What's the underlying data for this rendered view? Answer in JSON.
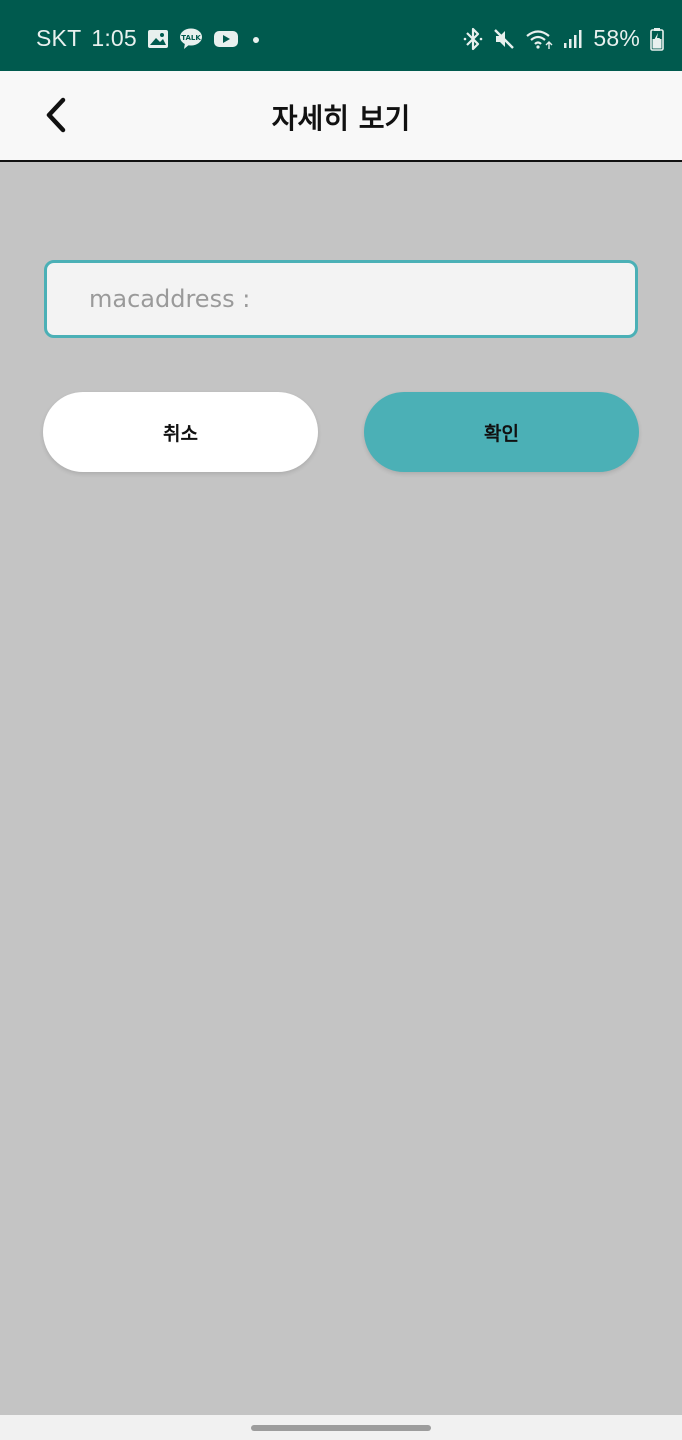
{
  "status_bar": {
    "carrier": "SKT",
    "time": "1:05",
    "battery": "58%",
    "left_icons": [
      "image-icon",
      "talk-icon",
      "youtube-icon",
      "dot-icon"
    ],
    "right_icons": [
      "bluetooth-icon",
      "mute-icon",
      "wifi-icon",
      "signal-icon",
      "battery-icon"
    ]
  },
  "app_bar": {
    "title": "자세히 보기",
    "back_icon": "chevron-left-icon"
  },
  "form": {
    "mac_placeholder": "macaddress :",
    "mac_value": ""
  },
  "actions": {
    "cancel_label": "취소",
    "confirm_label": "확인"
  },
  "colors": {
    "status_bar": "#005a4e",
    "accent": "#4bb0b6",
    "background": "#c4c4c4",
    "app_bar": "#f8f8f8"
  }
}
